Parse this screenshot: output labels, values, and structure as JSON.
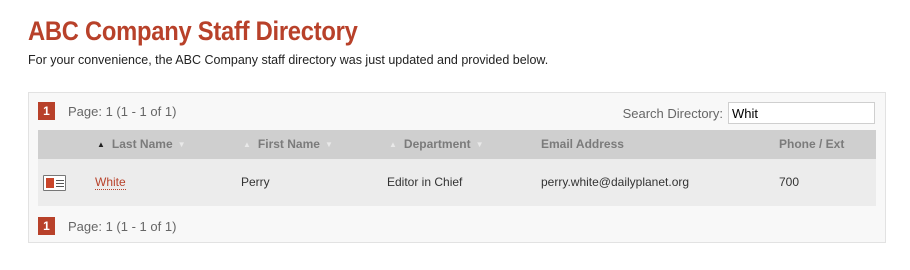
{
  "header": {
    "title": "ABC Company Staff Directory",
    "intro": "For your convenience, the ABC Company staff directory was just updated and provided below."
  },
  "pager": {
    "current_page": "1",
    "info": "Page: 1 (1 - 1 of 1)"
  },
  "search": {
    "label": "Search Directory:",
    "value": "Whit"
  },
  "table": {
    "columns": {
      "last_name": "Last Name",
      "first_name": "First Name",
      "department": "Department",
      "email": "Email Address",
      "phone": "Phone / Ext"
    },
    "sort": {
      "column": "last_name",
      "direction": "ascending"
    },
    "rows": [
      {
        "icon": "vcard-icon",
        "last_name": "White",
        "first_name": "Perry",
        "department": "Editor in Chief",
        "email": "perry.white@dailyplanet.org",
        "phone": "700"
      }
    ]
  },
  "colors": {
    "accent": "#b8412a",
    "header_bg": "#cfcfcf",
    "row_bg": "#ececec"
  }
}
